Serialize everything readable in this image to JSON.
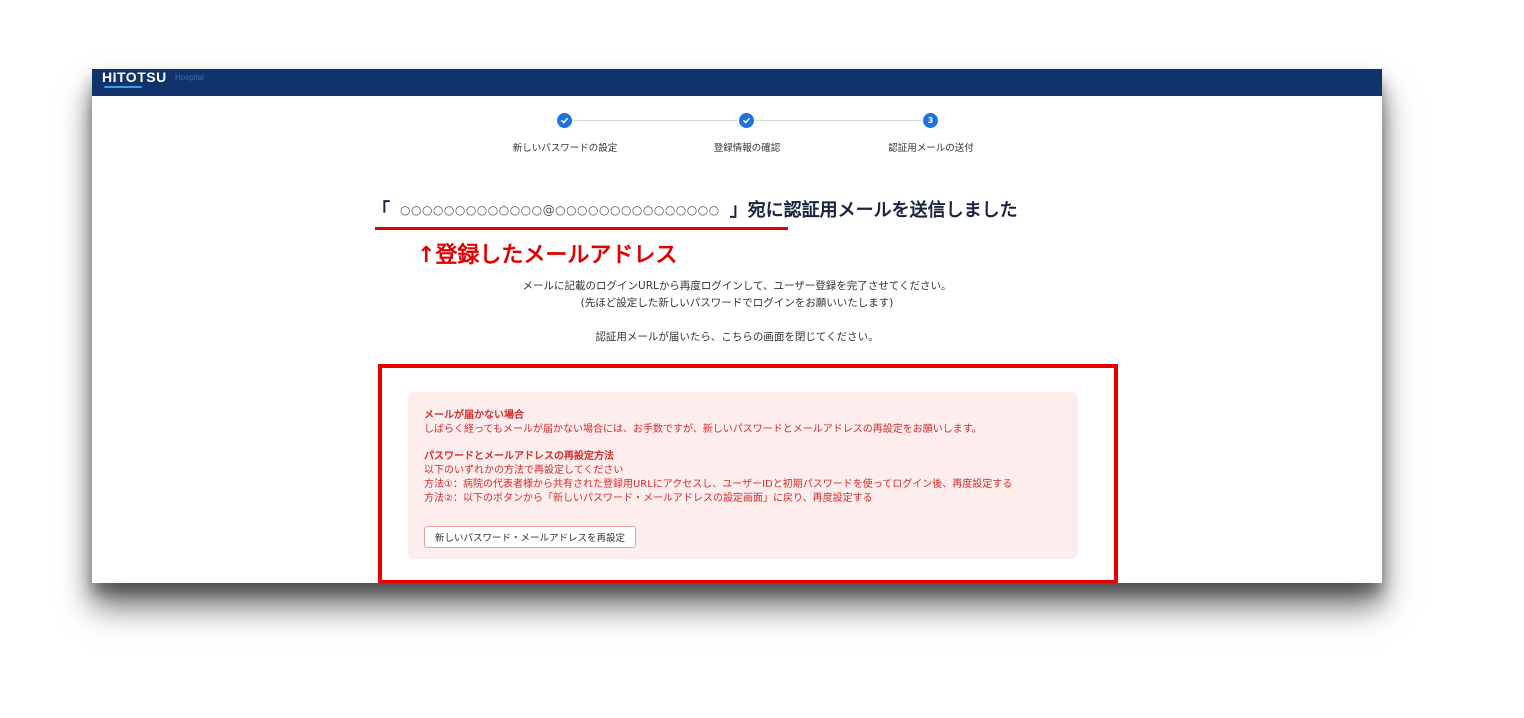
{
  "header": {
    "brand": "HITOTSU",
    "brand_sub": "Hospital"
  },
  "steps": [
    {
      "label": "新しいパスワードの設定",
      "state": "done",
      "number": ""
    },
    {
      "label": "登録情報の確認",
      "state": "done",
      "number": ""
    },
    {
      "label": "認証用メールの送付",
      "state": "current",
      "number": "3"
    }
  ],
  "headline": {
    "open_bracket": "「",
    "email": "○○○○○○○○○○○○○@○○○○○○○○○○○○○○○",
    "close_bracket": "」",
    "text": "宛に認証用メールを送信しました"
  },
  "annotation": "↑登録したメールアドレス",
  "info": {
    "line1": "メールに記載のログインURLから再度ログインして、ユーザー登録を完了させてください。",
    "line2": "(先ほど設定した新しいパスワードでログインをお願いいたします)",
    "line3": "認証用メールが届いたら、こちらの画面を閉じてください。"
  },
  "notice": {
    "title1": "メールが届かない場合",
    "body1": "しばらく経ってもメールが届かない場合には、お手数ですが、新しいパスワードとメールアドレスの再設定をお願いします。",
    "title2": "パスワードとメールアドレスの再設定方法",
    "body2": "以下のいずれかの方法で再設定してください",
    "method1": "方法①：病院の代表者様から共有された登録用URLにアクセスし、ユーザーIDと初期パスワードを使ってログイン後、再度設定する",
    "method2": "方法②：以下のボタンから「新しいパスワード・メールアドレスの設定画面」に戻り、再度設定する",
    "button": "新しいパスワード・メールアドレスを再設定"
  },
  "colors": {
    "topbar": "#10336b",
    "step_active": "#1f72e0",
    "annotation_red": "#e00000",
    "notice_bg": "#fdeded",
    "notice_text": "#d62c2c"
  }
}
